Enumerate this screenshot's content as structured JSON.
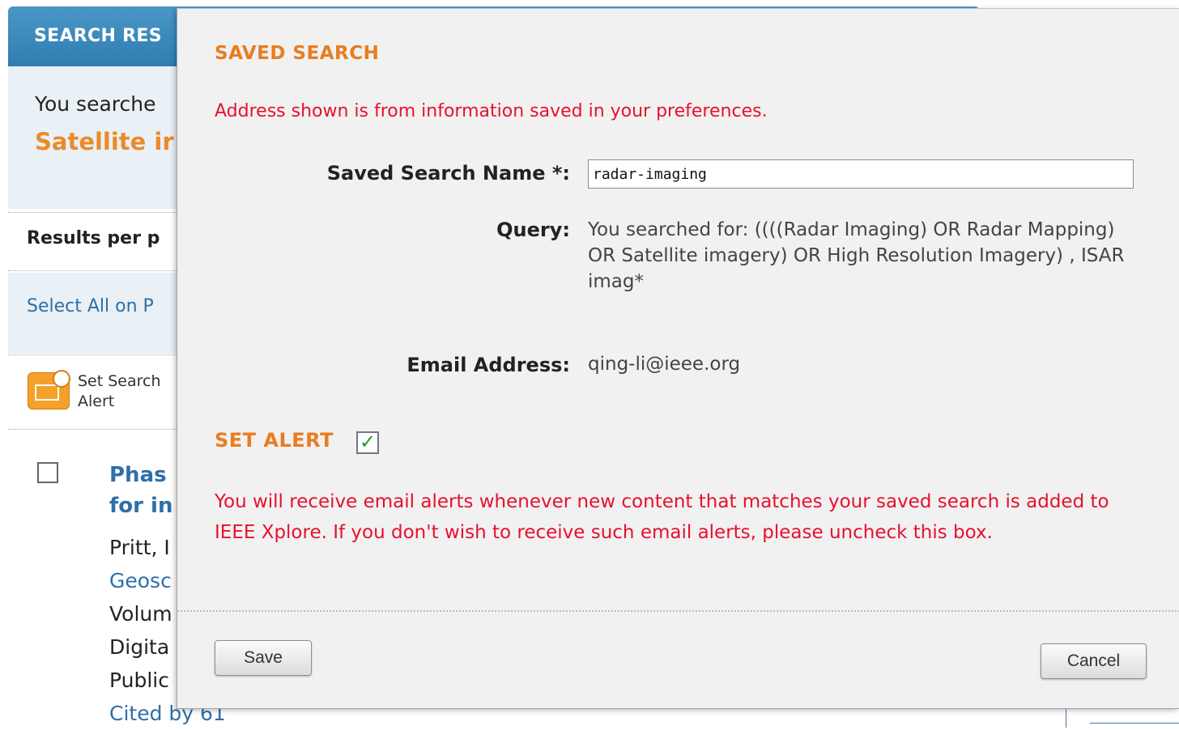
{
  "background": {
    "header": "SEARCH RES",
    "you_searched": "You searche",
    "query_title": "Satellite ir",
    "results_per_page": "Results per p",
    "select_all": "Select All on P",
    "set_search_alert": "Set Search Alert",
    "result": {
      "title": "Phas for in",
      "author": "Pritt, I",
      "journal": "Geosc",
      "volume": "Volum",
      "digital": "Digita",
      "published": "Public",
      "cited": "Cited by 61"
    }
  },
  "modal": {
    "title": "SAVED SEARCH",
    "preferences_note": "Address shown is from information saved in your preferences.",
    "name_label": "Saved Search Name *:",
    "name_value": "radar-imaging",
    "query_label": "Query:",
    "query_value": "You searched for: ((((Radar Imaging) OR Radar Mapping) OR Satellite imagery) OR High Resolution Imagery) ,  ISAR imag*",
    "email_label": "Email Address:",
    "email_value": "qing-li@ieee.org",
    "set_alert_label": "SET ALERT",
    "set_alert_checked": true,
    "alert_description": "You will receive email alerts whenever new content that matches your saved search is added to IEEE Xplore. If you don't wish to receive such email alerts, please uncheck this box.",
    "save_label": "Save",
    "cancel_label": "Cancel"
  },
  "colors": {
    "accent_orange": "#e87d20",
    "warning_red": "#e8102d",
    "header_blue": "#2f7db2",
    "link_blue": "#2f6fa7"
  }
}
